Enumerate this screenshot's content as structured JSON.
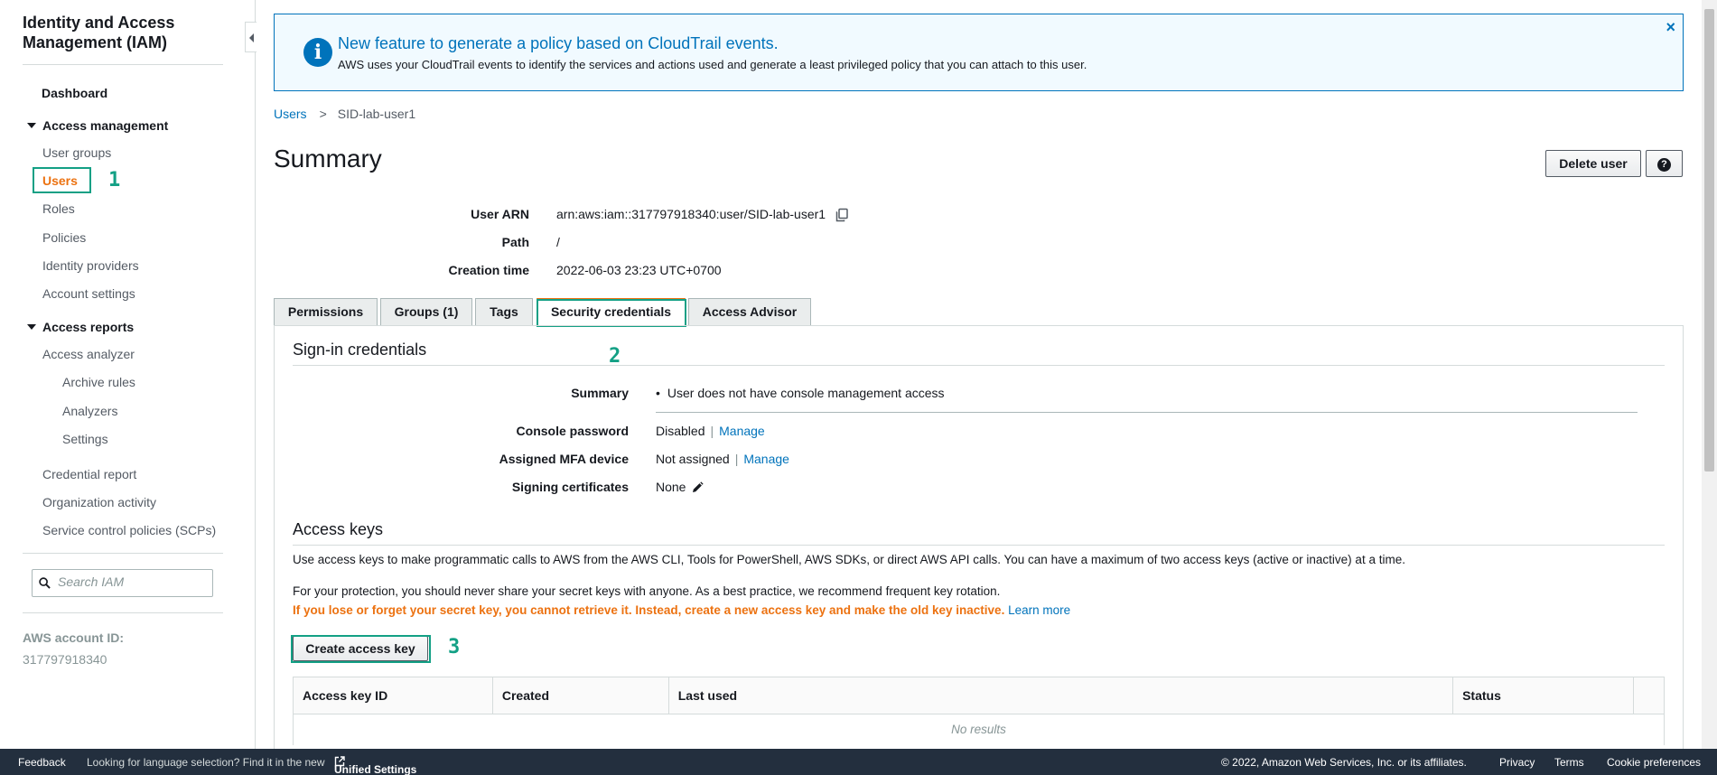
{
  "sidebar": {
    "title": "Identity and Access Management (IAM)",
    "dashboard": "Dashboard",
    "access_management": "Access management",
    "items_am": [
      "User groups",
      "Users",
      "Roles",
      "Policies",
      "Identity providers",
      "Account settings"
    ],
    "access_reports": "Access reports",
    "access_analyzer": "Access analyzer",
    "analyzer_sub": [
      "Archive rules",
      "Analyzers",
      "Settings"
    ],
    "items_reports": [
      "Credential report",
      "Organization activity",
      "Service control policies (SCPs)"
    ],
    "search_placeholder": "Search IAM",
    "account_label": "AWS account ID:",
    "account_id": "317797918340"
  },
  "annotations": [
    "1",
    "2",
    "3"
  ],
  "banner": {
    "title": "New feature to generate a policy based on CloudTrail events.",
    "text": "AWS uses your CloudTrail events to identify the services and actions used and generate a least privileged policy that you can attach to this user.",
    "close": "×"
  },
  "breadcrumb": {
    "parent": "Users",
    "sep": ">",
    "current": "SID-lab-user1"
  },
  "page_title": "Summary",
  "buttons": {
    "delete_user": "Delete user",
    "help": "?"
  },
  "summary": {
    "user_arn_label": "User ARN",
    "user_arn": "arn:aws:iam::317797918340:user/SID-lab-user1",
    "path_label": "Path",
    "path": "/",
    "creation_label": "Creation time",
    "creation": "2022-06-03 23:23 UTC+0700"
  },
  "tabs": [
    "Permissions",
    "Groups (1)",
    "Tags",
    "Security credentials",
    "Access Advisor"
  ],
  "signin": {
    "title": "Sign-in credentials",
    "summary_label": "Summary",
    "summary_value": "User does not have console management access",
    "console_label": "Console password",
    "console_value": "Disabled",
    "mfa_label": "Assigned MFA device",
    "mfa_value": "Not assigned",
    "manage": "Manage",
    "pipe": "|",
    "signing_label": "Signing certificates",
    "signing_value": "None"
  },
  "access_keys": {
    "title": "Access keys",
    "para1": "Use access keys to make programmatic calls to AWS from the AWS CLI, Tools for PowerShell, AWS SDKs, or direct AWS API calls. You can have a maximum of two access keys (active or inactive) at a time.",
    "para2": "For your protection, you should never share your secret keys with anyone. As a best practice, we recommend frequent key rotation.",
    "warning": "If you lose or forget your secret key, you cannot retrieve it. Instead, create a new access key and make the old key inactive.",
    "learn_more": "Learn more",
    "create_button": "Create access key",
    "columns": [
      "Access key ID",
      "Created",
      "Last used",
      "Status"
    ],
    "no_results": "No results"
  },
  "footer": {
    "feedback": "Feedback",
    "language_msg": "Looking for language selection? Find it in the new",
    "unified_settings": "Unified Settings",
    "copyright": "© 2022, Amazon Web Services, Inc. or its affiliates.",
    "privacy": "Privacy",
    "terms": "Terms",
    "cookies": "Cookie preferences"
  },
  "colors": {
    "accent": "#ec7211",
    "link": "#0073bb",
    "annotation": "#13a085",
    "footer_bg": "#232f3e"
  }
}
